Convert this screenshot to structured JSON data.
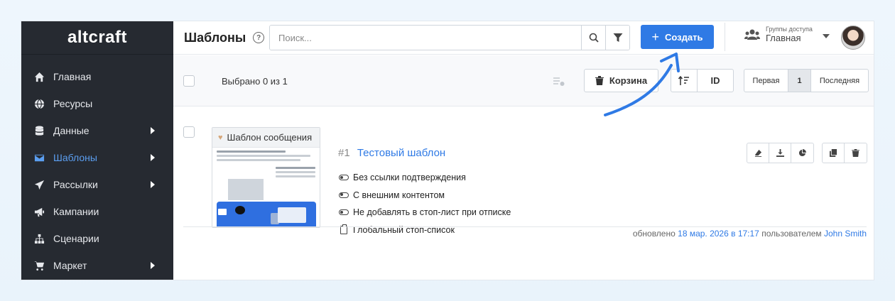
{
  "app": {
    "logo": "altcraft"
  },
  "sidebar": {
    "items": [
      {
        "label": "Главная",
        "icon": "home-icon",
        "has_arrow": false,
        "active": false
      },
      {
        "label": "Ресурсы",
        "icon": "globe-icon",
        "has_arrow": false,
        "active": false
      },
      {
        "label": "Данные",
        "icon": "database-icon",
        "has_arrow": true,
        "active": false
      },
      {
        "label": "Шаблоны",
        "icon": "envelope-icon",
        "has_arrow": true,
        "active": true
      },
      {
        "label": "Рассылки",
        "icon": "paper-plane-icon",
        "has_arrow": true,
        "active": false
      },
      {
        "label": "Кампании",
        "icon": "megaphone-icon",
        "has_arrow": false,
        "active": false
      },
      {
        "label": "Сценарии",
        "icon": "sitemap-icon",
        "has_arrow": false,
        "active": false
      },
      {
        "label": "Маркет",
        "icon": "cart-icon",
        "has_arrow": true,
        "active": false
      }
    ]
  },
  "header": {
    "title": "Шаблоны",
    "help": "?",
    "search_placeholder": "Поиск...",
    "create_label": "Создать",
    "groups_caption": "Группы доступа",
    "groups_value": "Главная"
  },
  "toolbar": {
    "selected_text": "Выбрано 0 из 1",
    "trash_label": "Корзина",
    "sort_label": "ID",
    "pager": {
      "first": "Первая",
      "current": "1",
      "last": "Последняя"
    }
  },
  "template": {
    "id": "#1",
    "name": "Тестовый шаблон",
    "thumbnail_title": "Шаблон сообщения",
    "props": [
      {
        "label": "Без ссылки подтверждения",
        "icon": "toggle-icon"
      },
      {
        "label": "С внешним контентом",
        "icon": "toggle-icon"
      },
      {
        "label": "Не добавлять в стоп-лист при отписке",
        "icon": "toggle-icon"
      },
      {
        "label": "Глобальный стоп-список",
        "icon": "clipboard-icon"
      }
    ],
    "updated_prefix": "обновлено",
    "updated_date": "18 мар. 2026 в 17:17",
    "updated_middle": "пользователем",
    "updated_user": "John Smith"
  },
  "colors": {
    "accent": "#2f7ae5",
    "sidebar_bg": "#262a31",
    "sidebar_active": "#5b9ef0"
  }
}
